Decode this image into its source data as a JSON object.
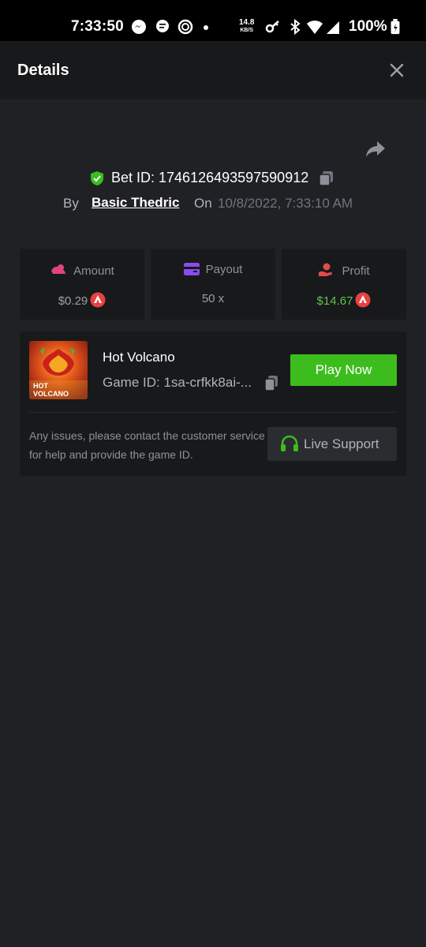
{
  "status_bar": {
    "time": "7:33:50",
    "net_speed": "14.8",
    "net_unit": "KB/S",
    "battery": "100%"
  },
  "header": {
    "title": "Details"
  },
  "bet": {
    "id_text": "Bet ID: 1746126493597590912",
    "by_label": "By",
    "user": "Basic Thedric",
    "on_label": "On",
    "date": "10/8/2022, 7:33:10 AM"
  },
  "stats": [
    {
      "label": "Amount",
      "value": "$0.29",
      "icon": "amount-icon",
      "color": "#e0457a"
    },
    {
      "label": "Payout",
      "value": "50 x",
      "icon": "payout-icon",
      "color": "#8a4cf0"
    },
    {
      "label": "Profit",
      "value": "$14.67",
      "icon": "profit-icon",
      "color": "#e34a4a"
    }
  ],
  "game": {
    "name": "Hot Volcano",
    "id_text": "Game ID: 1sa-crfkk8ai-...",
    "play_label": "Play Now",
    "thumb_line1": "HOT",
    "thumb_line2": "VOLCANO",
    "help": "Any issues, please contact the customer service for help and provide the game ID.",
    "support_label": "Live Support"
  },
  "colors": {
    "accent_green": "#3dbd1d",
    "profit_green": "#5ec24e",
    "coin_red": "#e84142"
  }
}
